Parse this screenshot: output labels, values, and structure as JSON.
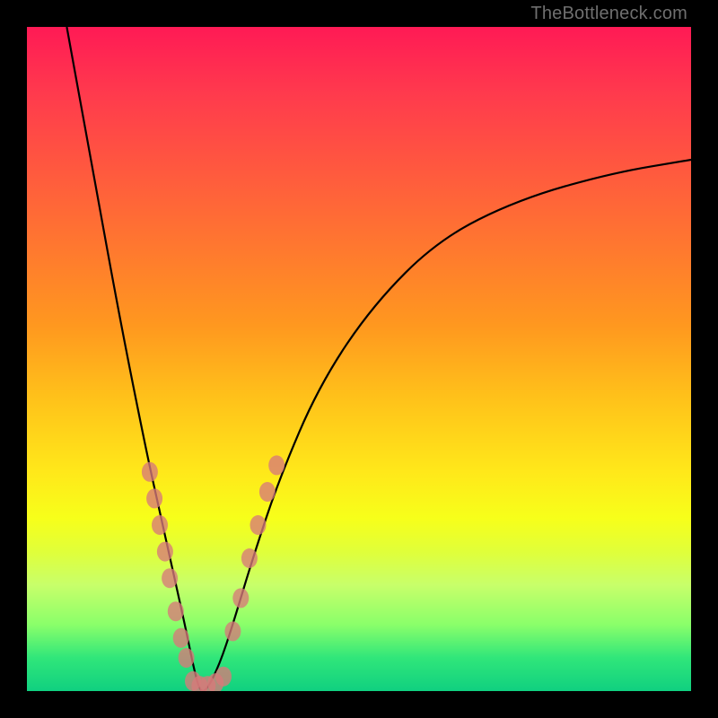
{
  "watermark": "TheBottleneck.com",
  "colors": {
    "frame": "#000000",
    "gradient_top": "#ff1a55",
    "gradient_bottom": "#10d080",
    "marker": "#d77a7a",
    "curve": "#000000"
  },
  "chart_data": {
    "type": "line",
    "title": "",
    "xlabel": "",
    "ylabel": "",
    "xlim": [
      0,
      100
    ],
    "ylim": [
      0,
      100
    ],
    "note": "Axes and ticks not shown. x is horizontal position (% from left), y is bottleneck percentage (% from bottom). Curve has a sharp V-shaped minimum near x≈26 reaching y≈0, rising steeply on both sides. Scatter markers concentrate along the curve near the minimum.",
    "series": [
      {
        "name": "bottleneck-curve",
        "x": [
          6,
          10,
          14,
          18,
          20,
          22,
          24,
          25,
          26,
          27,
          29,
          31,
          34,
          38,
          44,
          52,
          62,
          74,
          88,
          100
        ],
        "y": [
          100,
          78,
          56,
          36,
          27,
          18,
          9,
          4,
          0,
          0,
          4,
          10,
          20,
          32,
          46,
          58,
          68,
          74,
          78,
          80
        ]
      }
    ],
    "scatter": [
      {
        "name": "left-cluster",
        "points": [
          {
            "x": 18.5,
            "y": 33
          },
          {
            "x": 19.2,
            "y": 29
          },
          {
            "x": 20.0,
            "y": 25
          },
          {
            "x": 20.8,
            "y": 21
          },
          {
            "x": 21.5,
            "y": 17
          },
          {
            "x": 22.4,
            "y": 12
          },
          {
            "x": 23.2,
            "y": 8
          },
          {
            "x": 24.0,
            "y": 5
          }
        ]
      },
      {
        "name": "valley-cluster",
        "points": [
          {
            "x": 25.0,
            "y": 1.5
          },
          {
            "x": 26.0,
            "y": 0.8
          },
          {
            "x": 27.2,
            "y": 0.8
          },
          {
            "x": 28.4,
            "y": 1.2
          },
          {
            "x": 29.6,
            "y": 2.2
          }
        ]
      },
      {
        "name": "right-cluster",
        "points": [
          {
            "x": 31.0,
            "y": 9
          },
          {
            "x": 32.2,
            "y": 14
          },
          {
            "x": 33.5,
            "y": 20
          },
          {
            "x": 34.8,
            "y": 25
          },
          {
            "x": 36.2,
            "y": 30
          },
          {
            "x": 37.6,
            "y": 34
          }
        ]
      }
    ]
  }
}
